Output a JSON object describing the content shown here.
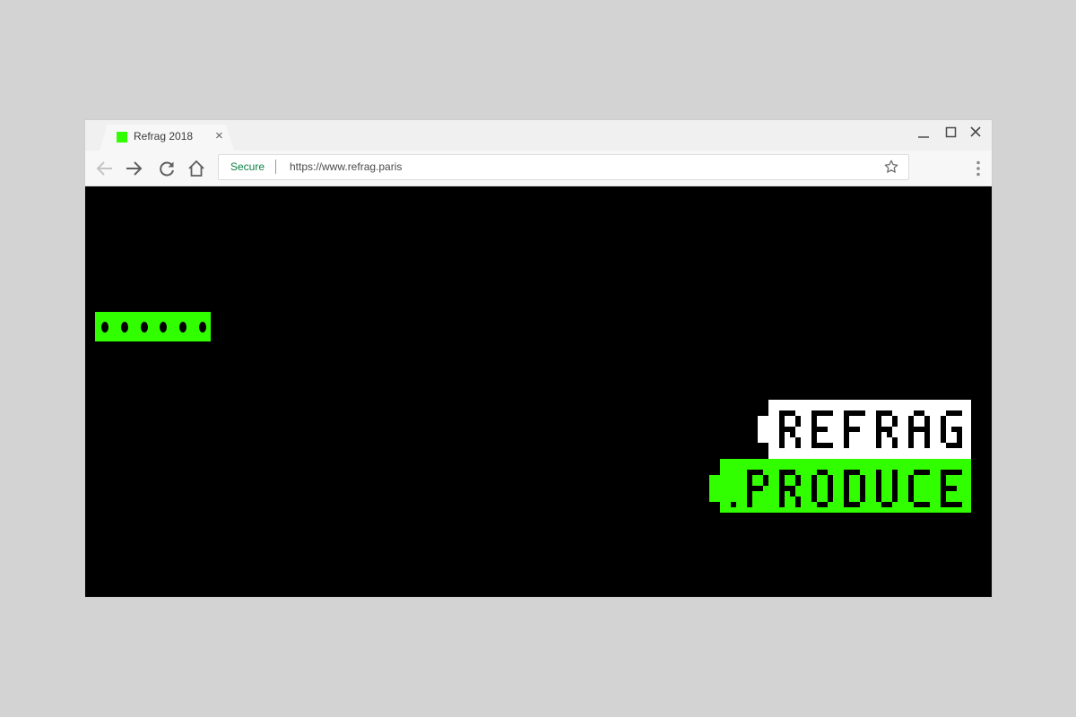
{
  "browser": {
    "tab": {
      "title": "Refrag 2018",
      "favicon_color": "#31ff00",
      "close_glyph": "×"
    },
    "window_controls": {
      "minimize": "—",
      "maximize": "☐",
      "close": "✕"
    },
    "toolbar": {
      "back_icon": "arrow-left-icon",
      "forward_icon": "arrow-right-icon",
      "reload_icon": "reload-icon",
      "home_icon": "home-icon",
      "security_label": "Secure",
      "url": "https://www.refrag.paris",
      "bookmark_icon": "star-icon",
      "menu_icon": "kebab-menu-icon"
    }
  },
  "page": {
    "background": "#000000",
    "accent_color": "#31ff00",
    "loader": {
      "dots": 6
    },
    "logo": {
      "line1": "REFRAG",
      "line2": ".PRODUCE",
      "line1_color": "#ffffff",
      "line2_color": "#31ff00"
    }
  }
}
